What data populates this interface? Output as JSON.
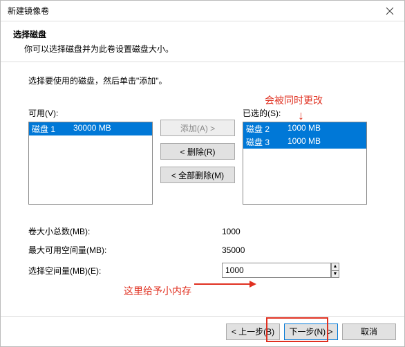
{
  "window": {
    "title": "新建镜像卷"
  },
  "header": {
    "title": "选择磁盘",
    "subtitle": "你可以选择磁盘并为此卷设置磁盘大小。"
  },
  "instruction": "选择要使用的磁盘，然后单击\"添加\"。",
  "available": {
    "label": "可用(V):",
    "items": [
      {
        "name": "磁盘 1",
        "size": "30000 MB"
      }
    ]
  },
  "selected": {
    "label": "已选的(S):",
    "items": [
      {
        "name": "磁盘 2",
        "size": "1000 MB"
      },
      {
        "name": "磁盘 3",
        "size": "1000 MB"
      }
    ]
  },
  "buttons": {
    "add": "添加(A) >",
    "remove": "< 删除(R)",
    "remove_all": "< 全部删除(M)"
  },
  "fields": {
    "total_label": "卷大小总数(MB):",
    "total_value": "1000",
    "max_label": "最大可用空间量(MB):",
    "max_value": "35000",
    "space_label": "选择空间量(MB)(E):",
    "space_value": "1000"
  },
  "footer": {
    "back": "< 上一步(B)",
    "next": "下一步(N) >",
    "cancel": "取消"
  },
  "annotations": {
    "top": "会被同时更改",
    "mid": "这里给予小内存"
  }
}
